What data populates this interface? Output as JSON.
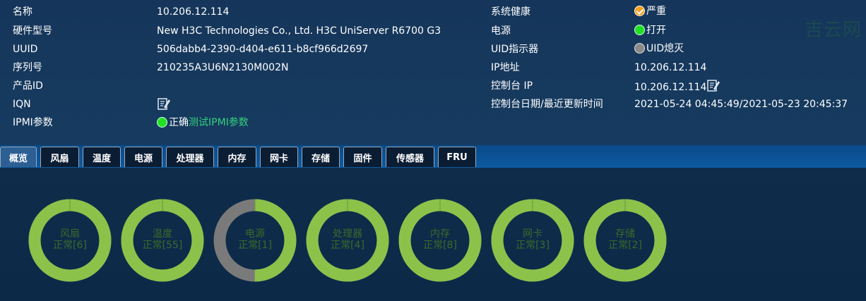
{
  "info_left": [
    {
      "label": "名称",
      "value": "10.206.12.114"
    },
    {
      "label": "硬件型号",
      "value": "New H3C Technologies Co., Ltd. H3C UniServer R6700 G3"
    },
    {
      "label": "UUID",
      "value": "506dabb4-2390-d404-e611-b8cf966d2697"
    },
    {
      "label": "序列号",
      "value": "210235A3U6N2130M002N"
    },
    {
      "label": "产品ID",
      "value": ""
    },
    {
      "label": "IQN",
      "value": ""
    },
    {
      "label": "IPMI参数",
      "value": "正确",
      "link": "测试IPMI参数"
    }
  ],
  "info_right": [
    {
      "label": "系统健康",
      "value": "严重"
    },
    {
      "label": "电源",
      "value": "打开"
    },
    {
      "label": "UID指示器",
      "value": "UID熄灭"
    },
    {
      "label": "IP地址",
      "value": "10.206.12.114"
    },
    {
      "label": "控制台 IP",
      "value": "10.206.12.114"
    },
    {
      "label": "控制台日期/最近更新时间",
      "value": "2021-05-24 04:45:49/2021-05-23 20:45:37"
    }
  ],
  "watermark": "吉云网",
  "tabs": [
    "概览",
    "风扇",
    "温度",
    "电源",
    "处理器",
    "内存",
    "网卡",
    "存储",
    "固件",
    "传感器",
    "FRU"
  ],
  "active_tab": "概览",
  "colors": {
    "ok": "#8bc34a",
    "off": "#7a7a7a",
    "status_ok": "#22e022",
    "status_warn": "#f4a020"
  },
  "donuts": [
    {
      "name": "风扇",
      "status": "正常[6]",
      "ok_fraction": 1.0
    },
    {
      "name": "温度",
      "status": "正常[55]",
      "ok_fraction": 1.0
    },
    {
      "name": "电源",
      "status": "正常[1]",
      "ok_fraction": 0.5
    },
    {
      "name": "处理器",
      "status": "正常[4]",
      "ok_fraction": 1.0
    },
    {
      "name": "内存",
      "status": "正常[8]",
      "ok_fraction": 1.0
    },
    {
      "name": "网卡",
      "status": "正常[3]",
      "ok_fraction": 1.0
    },
    {
      "name": "存储",
      "status": "正常[2]",
      "ok_fraction": 1.0
    }
  ]
}
